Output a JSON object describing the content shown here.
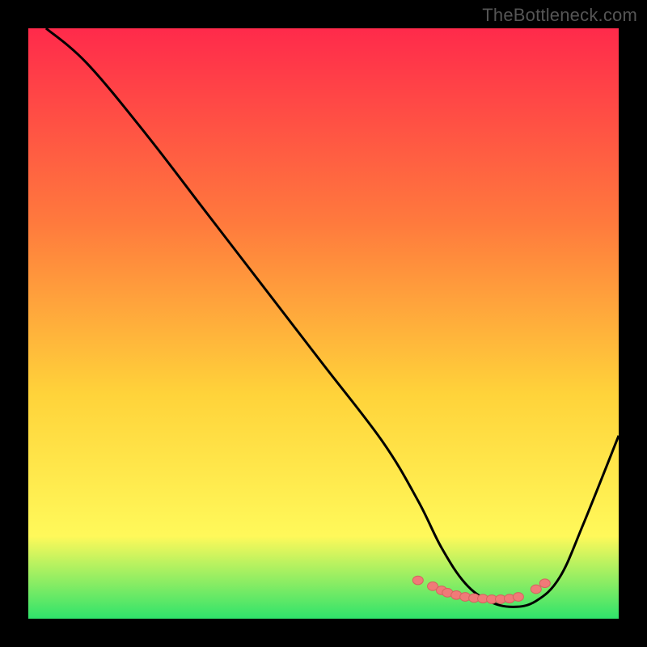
{
  "watermark": "TheBottleneck.com",
  "colors": {
    "background": "#000000",
    "gradient_top": "#ff2a4b",
    "gradient_mid1": "#ff7a3d",
    "gradient_mid2": "#ffd33a",
    "gradient_mid3": "#fff95a",
    "gradient_bottom": "#2fe36b",
    "curve": "#000000",
    "marker_fill": "#f07a78",
    "marker_stroke": "#d66360",
    "watermark_text": "#555555"
  },
  "chart_data": {
    "type": "line",
    "title": "",
    "xlabel": "",
    "ylabel": "",
    "xlim": [
      0,
      100
    ],
    "ylim": [
      0,
      100
    ],
    "series": [
      {
        "name": "curve",
        "x": [
          3,
          10,
          20,
          30,
          40,
          50,
          60,
          66,
          70,
          74,
          78,
          82,
          86,
          90,
          94,
          100
        ],
        "y": [
          100,
          94,
          82,
          69,
          56,
          43,
          30,
          20,
          12,
          6,
          3,
          2,
          3,
          7,
          16,
          31
        ]
      }
    ],
    "markers": {
      "name": "bottom-cluster",
      "x": [
        66,
        68.5,
        70,
        71,
        72.5,
        74,
        75.5,
        77,
        78.5,
        80,
        81.5,
        83,
        86,
        87.5
      ],
      "y": [
        6.5,
        5.5,
        4.8,
        4.4,
        4.0,
        3.7,
        3.5,
        3.4,
        3.3,
        3.3,
        3.4,
        3.7,
        5.0,
        6.0
      ]
    }
  }
}
